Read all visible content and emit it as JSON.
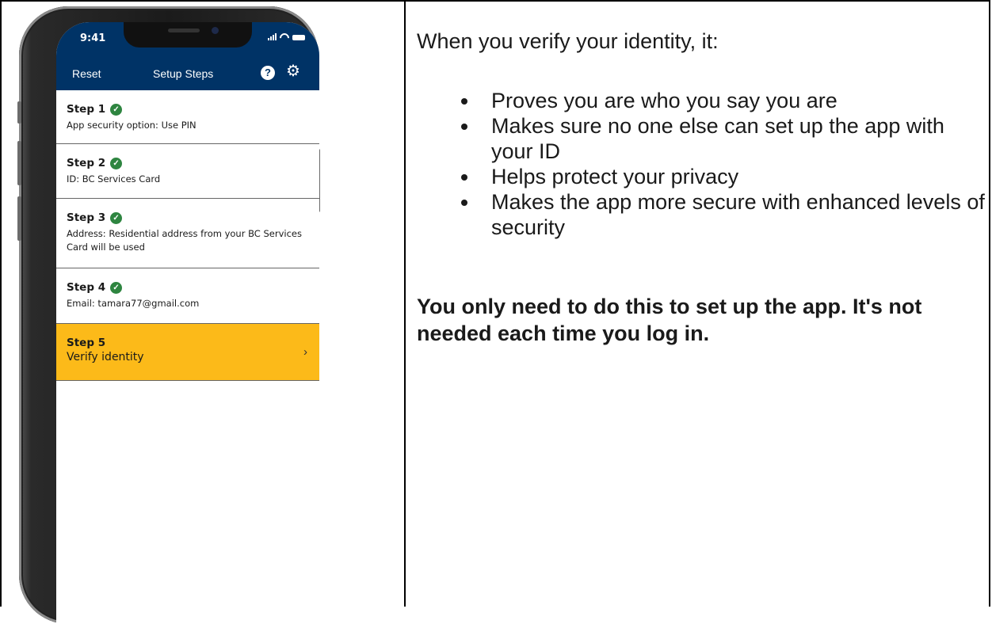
{
  "phone": {
    "status_time": "9:41",
    "nav": {
      "reset_label": "Reset",
      "title": "Setup Steps",
      "help_icon": "?",
      "gear_icon": "⚙"
    },
    "steps": [
      {
        "title": "Step 1",
        "detail": "App security option: Use PIN",
        "completed": true
      },
      {
        "title": "Step 2",
        "detail": "ID: BC Services Card",
        "completed": true
      },
      {
        "title": "Step 3",
        "detail": "Address: Residential address from your BC Services Card will be used",
        "completed": true
      },
      {
        "title": "Step 4",
        "detail": "Email: tamara77@gmail.com",
        "completed": true
      },
      {
        "title": "Step 5",
        "detail": "Verify identity",
        "completed": false,
        "active": true
      }
    ],
    "colors": {
      "header": "#003366",
      "active_step": "#fcba19",
      "check": "#2e8540"
    }
  },
  "content": {
    "intro": "When you verify your identity, it:",
    "bullets": [
      "Proves you are who you say you are",
      "Makes sure no one else can set up the app with your ID",
      "Helps protect your privacy",
      "Makes the app more secure with enhanced levels of security"
    ],
    "note": "You only need to do this to set up the app. It's not needed each time you log in."
  }
}
